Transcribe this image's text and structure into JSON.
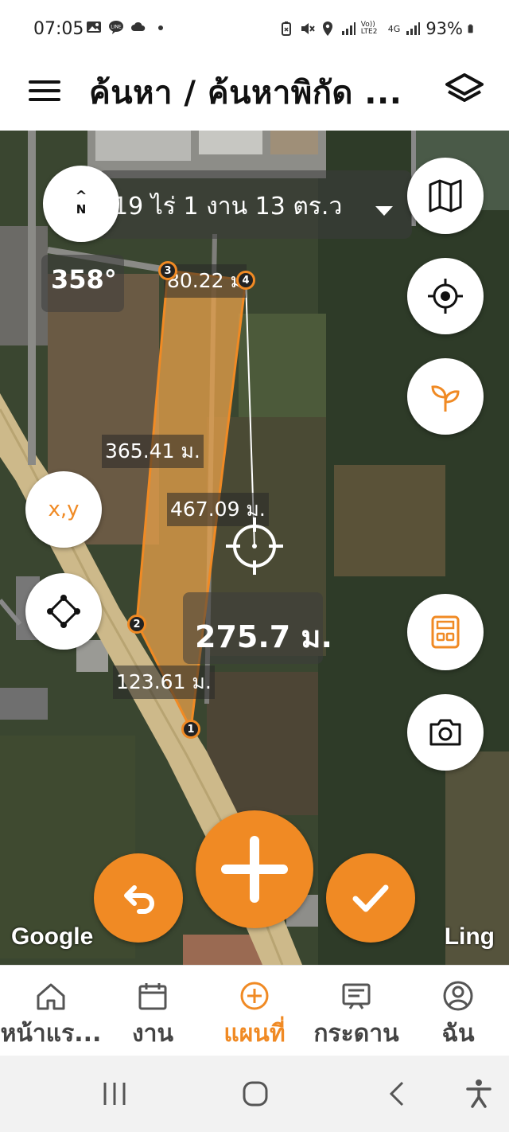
{
  "status_bar": {
    "time": "07:05",
    "network_label": "Vo)) LTE2",
    "network_type": "4G",
    "battery": "93%"
  },
  "app_bar": {
    "title": "ค้นหา / ค้นหาพิกัด ...",
    "menu_icon": "menu-icon",
    "layers_icon": "layers-icon"
  },
  "map": {
    "area_summary": "19 ไร่ 1 งาน 13 ตร.ว",
    "heading": "358°",
    "compass_label": "N",
    "xy_button_label": "x,y",
    "segments": {
      "top": "80.22 ม",
      "left": "365.41 ม.",
      "bottom": "123.61 ม.",
      "measure_line": "467.09 ม."
    },
    "current_distance": "275.7 ม.",
    "vertices": [
      "1",
      "2",
      "3",
      "4"
    ],
    "attribution_left": "Google",
    "attribution_right": "Ling",
    "accent_color": "#f08a24",
    "parcel_fill": "#e9a24a"
  },
  "bottom_nav": {
    "items": [
      {
        "label": "หน้าแร...",
        "icon": "home-icon"
      },
      {
        "label": "งาน",
        "icon": "calendar-icon"
      },
      {
        "label": "แผนที่",
        "icon": "plus-circle-icon",
        "active": true
      },
      {
        "label": "กระดาน",
        "icon": "board-icon"
      },
      {
        "label": "ฉัน",
        "icon": "profile-icon"
      }
    ]
  },
  "system_nav": {
    "buttons": [
      "recent-apps-icon",
      "home-circle-icon",
      "back-icon",
      "accessibility-icon"
    ]
  }
}
